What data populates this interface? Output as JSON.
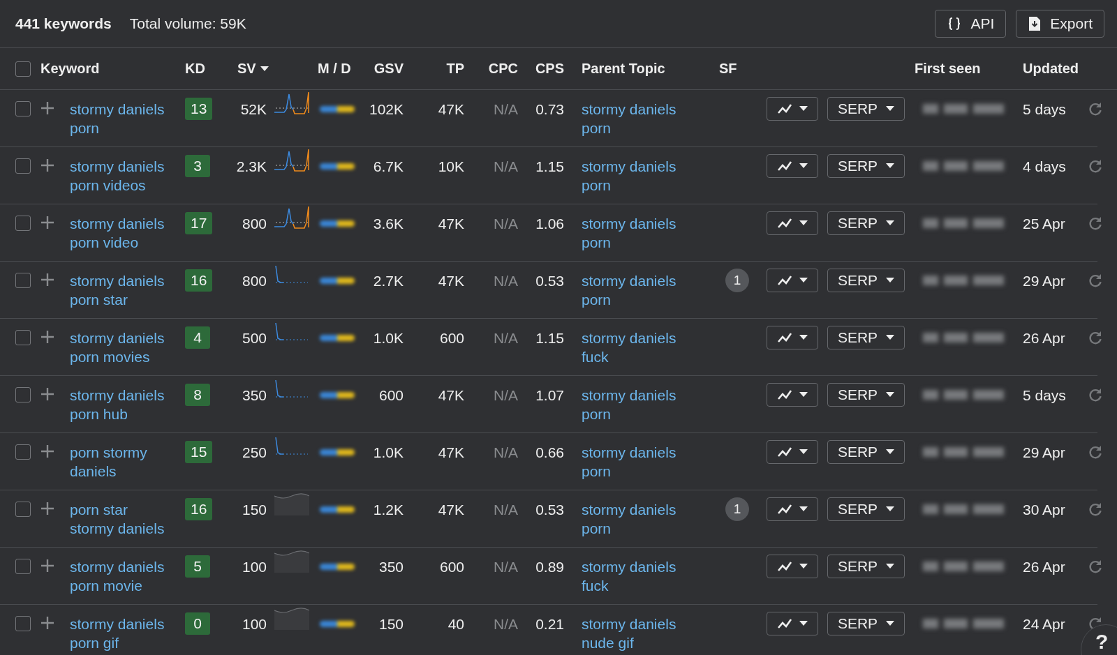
{
  "summary": {
    "count": "441 keywords",
    "total": "Total volume: 59K"
  },
  "select_all": {
    "checked": false
  },
  "actions": [
    {
      "kind": "api",
      "label": "API"
    },
    {
      "kind": "export",
      "label": "Export"
    }
  ],
  "columns": {
    "keyword": "Keyword",
    "kd": "KD",
    "sv": "SV",
    "md": "M / D",
    "gsv": "GSV",
    "tp": "TP",
    "cpc": "CPC",
    "cps": "CPS",
    "parent": "Parent Topic",
    "sf": "SF",
    "first_seen": "First seen",
    "updated": "Updated"
  },
  "rows": [
    {
      "checked": false,
      "keyword": "stormy daniels porn",
      "kd": "13",
      "sv": "52K",
      "kind": "spikes",
      "gsv": "102K",
      "tp": "47K",
      "cpc": "N/A",
      "cps": "0.73",
      "parent": "stormy daniels porn",
      "serp": "SERP",
      "updated": "5 days"
    },
    {
      "checked": false,
      "keyword": "stormy daniels porn videos",
      "kd": "3",
      "sv": "2.3K",
      "kind": "spikes",
      "gsv": "6.7K",
      "tp": "10K",
      "cpc": "N/A",
      "cps": "1.15",
      "parent": "stormy daniels porn",
      "serp": "SERP",
      "updated": "4 days"
    },
    {
      "checked": false,
      "keyword": "stormy daniels porn video",
      "kd": "17",
      "sv": "800",
      "kind": "spikes",
      "gsv": "3.6K",
      "tp": "47K",
      "cpc": "N/A",
      "cps": "1.06",
      "parent": "stormy daniels porn",
      "serp": "SERP",
      "updated": "25 Apr"
    },
    {
      "checked": false,
      "keyword": "stormy daniels porn star",
      "kd": "16",
      "sv": "800",
      "kind": "decay",
      "gsv": "2.7K",
      "tp": "47K",
      "cpc": "N/A",
      "cps": "0.53",
      "parent": "stormy daniels porn",
      "sf": "1",
      "serp": "SERP",
      "updated": "29 Apr"
    },
    {
      "checked": false,
      "keyword": "stormy daniels porn movies",
      "kd": "4",
      "sv": "500",
      "kind": "decay",
      "gsv": "1.0K",
      "tp": "600",
      "cpc": "N/A",
      "cps": "1.15",
      "parent": "stormy daniels fuck",
      "serp": "SERP",
      "updated": "26 Apr"
    },
    {
      "checked": false,
      "keyword": "stormy daniels porn hub",
      "kd": "8",
      "sv": "350",
      "kind": "decay",
      "gsv": "600",
      "tp": "47K",
      "cpc": "N/A",
      "cps": "1.07",
      "parent": "stormy daniels porn",
      "serp": "SERP",
      "updated": "5 days"
    },
    {
      "checked": false,
      "keyword": "porn stormy daniels",
      "kd": "15",
      "sv": "250",
      "kind": "decay",
      "gsv": "1.0K",
      "tp": "47K",
      "cpc": "N/A",
      "cps": "0.66",
      "parent": "stormy daniels porn",
      "serp": "SERP",
      "updated": "29 Apr"
    },
    {
      "checked": false,
      "keyword": "porn star stormy daniels",
      "kd": "16",
      "sv": "150",
      "kind": "wave",
      "gsv": "1.2K",
      "tp": "47K",
      "cpc": "N/A",
      "cps": "0.53",
      "parent": "stormy daniels porn",
      "sf": "1",
      "serp": "SERP",
      "updated": "30 Apr"
    },
    {
      "checked": false,
      "keyword": "stormy daniels porn movie",
      "kd": "5",
      "sv": "100",
      "kind": "wave",
      "gsv": "350",
      "tp": "600",
      "cpc": "N/A",
      "cps": "0.89",
      "parent": "stormy daniels fuck",
      "serp": "SERP",
      "updated": "26 Apr"
    },
    {
      "checked": false,
      "keyword": "stormy daniels porn gif",
      "kd": "0",
      "sv": "100",
      "kind": "wave",
      "gsv": "150",
      "tp": "40",
      "cpc": "N/A",
      "cps": "0.21",
      "parent": "stormy daniels nude gif",
      "serp": "SERP",
      "updated": "24 Apr"
    }
  ],
  "help": {
    "label": "?"
  }
}
